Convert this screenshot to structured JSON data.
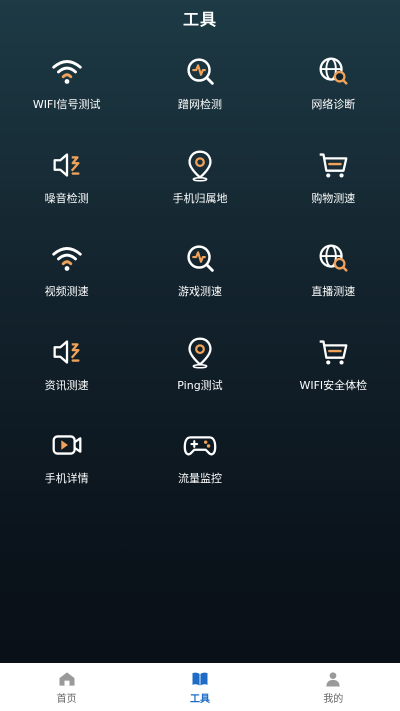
{
  "header": {
    "title": "工具"
  },
  "tools": [
    {
      "label": "WIFI信号测试",
      "icon": "wifi-icon"
    },
    {
      "label": "蹭网检测",
      "icon": "chat-pulse-icon"
    },
    {
      "label": "网络诊断",
      "icon": "globe-search-icon"
    },
    {
      "label": "噪音检测",
      "icon": "speaker-icon"
    },
    {
      "label": "手机归属地",
      "icon": "location-pin-icon"
    },
    {
      "label": "购物测速",
      "icon": "shopping-cart-icon"
    },
    {
      "label": "视频测速",
      "icon": "wifi-icon"
    },
    {
      "label": "游戏测速",
      "icon": "chat-pulse-icon"
    },
    {
      "label": "直播测速",
      "icon": "globe-search-icon"
    },
    {
      "label": "资讯测速",
      "icon": "speaker-icon"
    },
    {
      "label": "Ping测试",
      "icon": "location-pin-icon"
    },
    {
      "label": "WIFI安全体检",
      "icon": "shopping-cart-icon"
    },
    {
      "label": "手机详情",
      "icon": "video-camera-icon"
    },
    {
      "label": "流量监控",
      "icon": "gamepad-icon"
    }
  ],
  "tabbar": {
    "items": [
      {
        "label": "首页",
        "icon": "home-icon",
        "active": false
      },
      {
        "label": "工具",
        "icon": "book-icon",
        "active": true
      },
      {
        "label": "我的",
        "icon": "person-icon",
        "active": false
      }
    ]
  },
  "colors": {
    "accent": "#f0a25a",
    "tab_active": "#1f6cc7"
  }
}
